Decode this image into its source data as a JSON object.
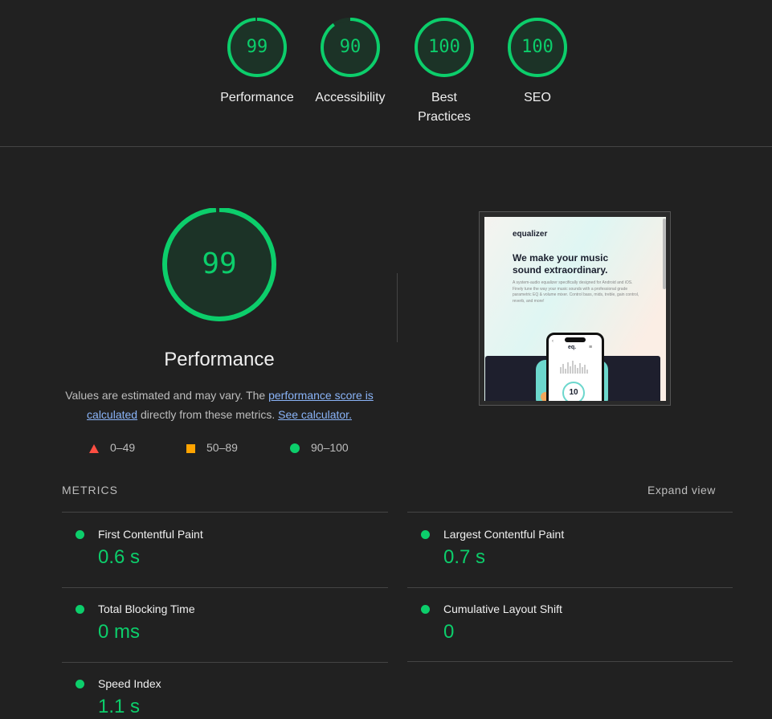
{
  "categories": [
    {
      "score": "99",
      "score_value": 99,
      "label": "Performance"
    },
    {
      "score": "90",
      "score_value": 90,
      "label": "Accessibility"
    },
    {
      "score": "100",
      "score_value": 100,
      "label": "Best Practices"
    },
    {
      "score": "100",
      "score_value": 100,
      "label": "SEO"
    }
  ],
  "performance": {
    "score": "99",
    "score_value": 99,
    "title": "Performance",
    "desc_prefix": "Values are estimated and may vary. The ",
    "desc_link": "performance score is calculated",
    "desc_middle": " directly from these metrics. ",
    "calc_link": "See calculator.",
    "legend": [
      {
        "range": "0–49",
        "icon": "triangle-icon",
        "color": "#ff4e42"
      },
      {
        "range": "50–89",
        "icon": "square-icon",
        "color": "#ffa400"
      },
      {
        "range": "90–100",
        "icon": "circle-icon",
        "color": "#0cce6b"
      }
    ]
  },
  "screenshot": {
    "brand": "equalizer",
    "headline": "We make your music sound extraordinary.",
    "body": "A system-audio equalizer specifically designed for Android and iOS. Finely tune the way your music sounds with a professional grade parametric EQ & volume mixer. Control bass, mids, treble, gain control, reverb, and more!",
    "phone_logo": "eq.",
    "phone_value": "10"
  },
  "metrics": {
    "heading": "METRICS",
    "expand_label": "Expand view",
    "items": [
      {
        "name": "First Contentful Paint",
        "value": "0.6 s"
      },
      {
        "name": "Largest Contentful Paint",
        "value": "0.7 s"
      },
      {
        "name": "Total Blocking Time",
        "value": "0 ms"
      },
      {
        "name": "Cumulative Layout Shift",
        "value": "0"
      },
      {
        "name": "Speed Index",
        "value": "1.1 s"
      }
    ]
  },
  "colors": {
    "pass": "#0cce6b",
    "background": "#212121",
    "link": "#8ab4f8"
  }
}
